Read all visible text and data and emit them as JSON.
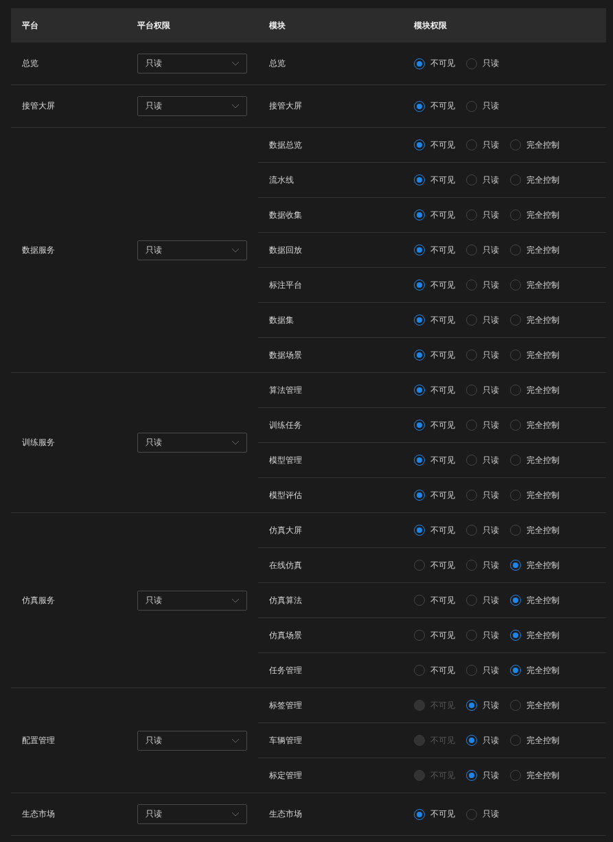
{
  "columns": [
    "平台",
    "平台权限",
    "模块",
    "模块权限"
  ],
  "groups": [
    {
      "platform": "总览",
      "permission": "只读",
      "modules": [
        {
          "name": "总览",
          "options": [
            {
              "label": "不可见",
              "selected": true,
              "disabled": false
            },
            {
              "label": "只读",
              "selected": false,
              "disabled": false
            }
          ]
        }
      ]
    },
    {
      "platform": "接管大屏",
      "permission": "只读",
      "modules": [
        {
          "name": "接管大屏",
          "options": [
            {
              "label": "不可见",
              "selected": true,
              "disabled": false
            },
            {
              "label": "只读",
              "selected": false,
              "disabled": false
            }
          ]
        }
      ]
    },
    {
      "platform": "数据服务",
      "permission": "只读",
      "modules": [
        {
          "name": "数据总览",
          "options": [
            {
              "label": "不可见",
              "selected": true,
              "disabled": false
            },
            {
              "label": "只读",
              "selected": false,
              "disabled": false
            },
            {
              "label": "完全控制",
              "selected": false,
              "disabled": false
            }
          ]
        },
        {
          "name": "流水线",
          "options": [
            {
              "label": "不可见",
              "selected": true,
              "disabled": false
            },
            {
              "label": "只读",
              "selected": false,
              "disabled": false
            },
            {
              "label": "完全控制",
              "selected": false,
              "disabled": false
            }
          ]
        },
        {
          "name": "数据收集",
          "options": [
            {
              "label": "不可见",
              "selected": true,
              "disabled": false
            },
            {
              "label": "只读",
              "selected": false,
              "disabled": false
            },
            {
              "label": "完全控制",
              "selected": false,
              "disabled": false
            }
          ]
        },
        {
          "name": "数据回放",
          "options": [
            {
              "label": "不可见",
              "selected": true,
              "disabled": false
            },
            {
              "label": "只读",
              "selected": false,
              "disabled": false
            },
            {
              "label": "完全控制",
              "selected": false,
              "disabled": false
            }
          ]
        },
        {
          "name": "标注平台",
          "options": [
            {
              "label": "不可见",
              "selected": true,
              "disabled": false
            },
            {
              "label": "只读",
              "selected": false,
              "disabled": false
            },
            {
              "label": "完全控制",
              "selected": false,
              "disabled": false
            }
          ]
        },
        {
          "name": "数据集",
          "options": [
            {
              "label": "不可见",
              "selected": true,
              "disabled": false
            },
            {
              "label": "只读",
              "selected": false,
              "disabled": false
            },
            {
              "label": "完全控制",
              "selected": false,
              "disabled": false
            }
          ]
        },
        {
          "name": "数据场景",
          "options": [
            {
              "label": "不可见",
              "selected": true,
              "disabled": false
            },
            {
              "label": "只读",
              "selected": false,
              "disabled": false
            },
            {
              "label": "完全控制",
              "selected": false,
              "disabled": false
            }
          ]
        }
      ]
    },
    {
      "platform": "训练服务",
      "permission": "只读",
      "modules": [
        {
          "name": "算法管理",
          "options": [
            {
              "label": "不可见",
              "selected": true,
              "disabled": false
            },
            {
              "label": "只读",
              "selected": false,
              "disabled": false
            },
            {
              "label": "完全控制",
              "selected": false,
              "disabled": false
            }
          ]
        },
        {
          "name": "训练任务",
          "options": [
            {
              "label": "不可见",
              "selected": true,
              "disabled": false
            },
            {
              "label": "只读",
              "selected": false,
              "disabled": false
            },
            {
              "label": "完全控制",
              "selected": false,
              "disabled": false
            }
          ]
        },
        {
          "name": "模型管理",
          "options": [
            {
              "label": "不可见",
              "selected": true,
              "disabled": false
            },
            {
              "label": "只读",
              "selected": false,
              "disabled": false
            },
            {
              "label": "完全控制",
              "selected": false,
              "disabled": false
            }
          ]
        },
        {
          "name": "模型评估",
          "options": [
            {
              "label": "不可见",
              "selected": true,
              "disabled": false
            },
            {
              "label": "只读",
              "selected": false,
              "disabled": false
            },
            {
              "label": "完全控制",
              "selected": false,
              "disabled": false
            }
          ]
        }
      ]
    },
    {
      "platform": "仿真服务",
      "permission": "只读",
      "modules": [
        {
          "name": "仿真大屏",
          "options": [
            {
              "label": "不可见",
              "selected": true,
              "disabled": false
            },
            {
              "label": "只读",
              "selected": false,
              "disabled": false
            },
            {
              "label": "完全控制",
              "selected": false,
              "disabled": false
            }
          ]
        },
        {
          "name": "在线仿真",
          "options": [
            {
              "label": "不可见",
              "selected": false,
              "disabled": false
            },
            {
              "label": "只读",
              "selected": false,
              "disabled": false
            },
            {
              "label": "完全控制",
              "selected": true,
              "disabled": false
            }
          ]
        },
        {
          "name": "仿真算法",
          "options": [
            {
              "label": "不可见",
              "selected": false,
              "disabled": false
            },
            {
              "label": "只读",
              "selected": false,
              "disabled": false
            },
            {
              "label": "完全控制",
              "selected": true,
              "disabled": false
            }
          ]
        },
        {
          "name": "仿真场景",
          "options": [
            {
              "label": "不可见",
              "selected": false,
              "disabled": false
            },
            {
              "label": "只读",
              "selected": false,
              "disabled": false
            },
            {
              "label": "完全控制",
              "selected": true,
              "disabled": false
            }
          ]
        },
        {
          "name": "任务管理",
          "options": [
            {
              "label": "不可见",
              "selected": false,
              "disabled": false
            },
            {
              "label": "只读",
              "selected": false,
              "disabled": false
            },
            {
              "label": "完全控制",
              "selected": true,
              "disabled": false
            }
          ]
        }
      ]
    },
    {
      "platform": "配置管理",
      "permission": "只读",
      "modules": [
        {
          "name": "标签管理",
          "options": [
            {
              "label": "不可见",
              "selected": false,
              "disabled": true
            },
            {
              "label": "只读",
              "selected": true,
              "disabled": false
            },
            {
              "label": "完全控制",
              "selected": false,
              "disabled": false
            }
          ]
        },
        {
          "name": "车辆管理",
          "options": [
            {
              "label": "不可见",
              "selected": false,
              "disabled": true
            },
            {
              "label": "只读",
              "selected": true,
              "disabled": false
            },
            {
              "label": "完全控制",
              "selected": false,
              "disabled": false
            }
          ]
        },
        {
          "name": "标定管理",
          "options": [
            {
              "label": "不可见",
              "selected": false,
              "disabled": true
            },
            {
              "label": "只读",
              "selected": true,
              "disabled": false
            },
            {
              "label": "完全控制",
              "selected": false,
              "disabled": false
            }
          ]
        }
      ]
    },
    {
      "platform": "生态市场",
      "permission": "只读",
      "modules": [
        {
          "name": "生态市场",
          "options": [
            {
              "label": "不可见",
              "selected": true,
              "disabled": false
            },
            {
              "label": "只读",
              "selected": false,
              "disabled": false
            }
          ]
        }
      ]
    }
  ]
}
